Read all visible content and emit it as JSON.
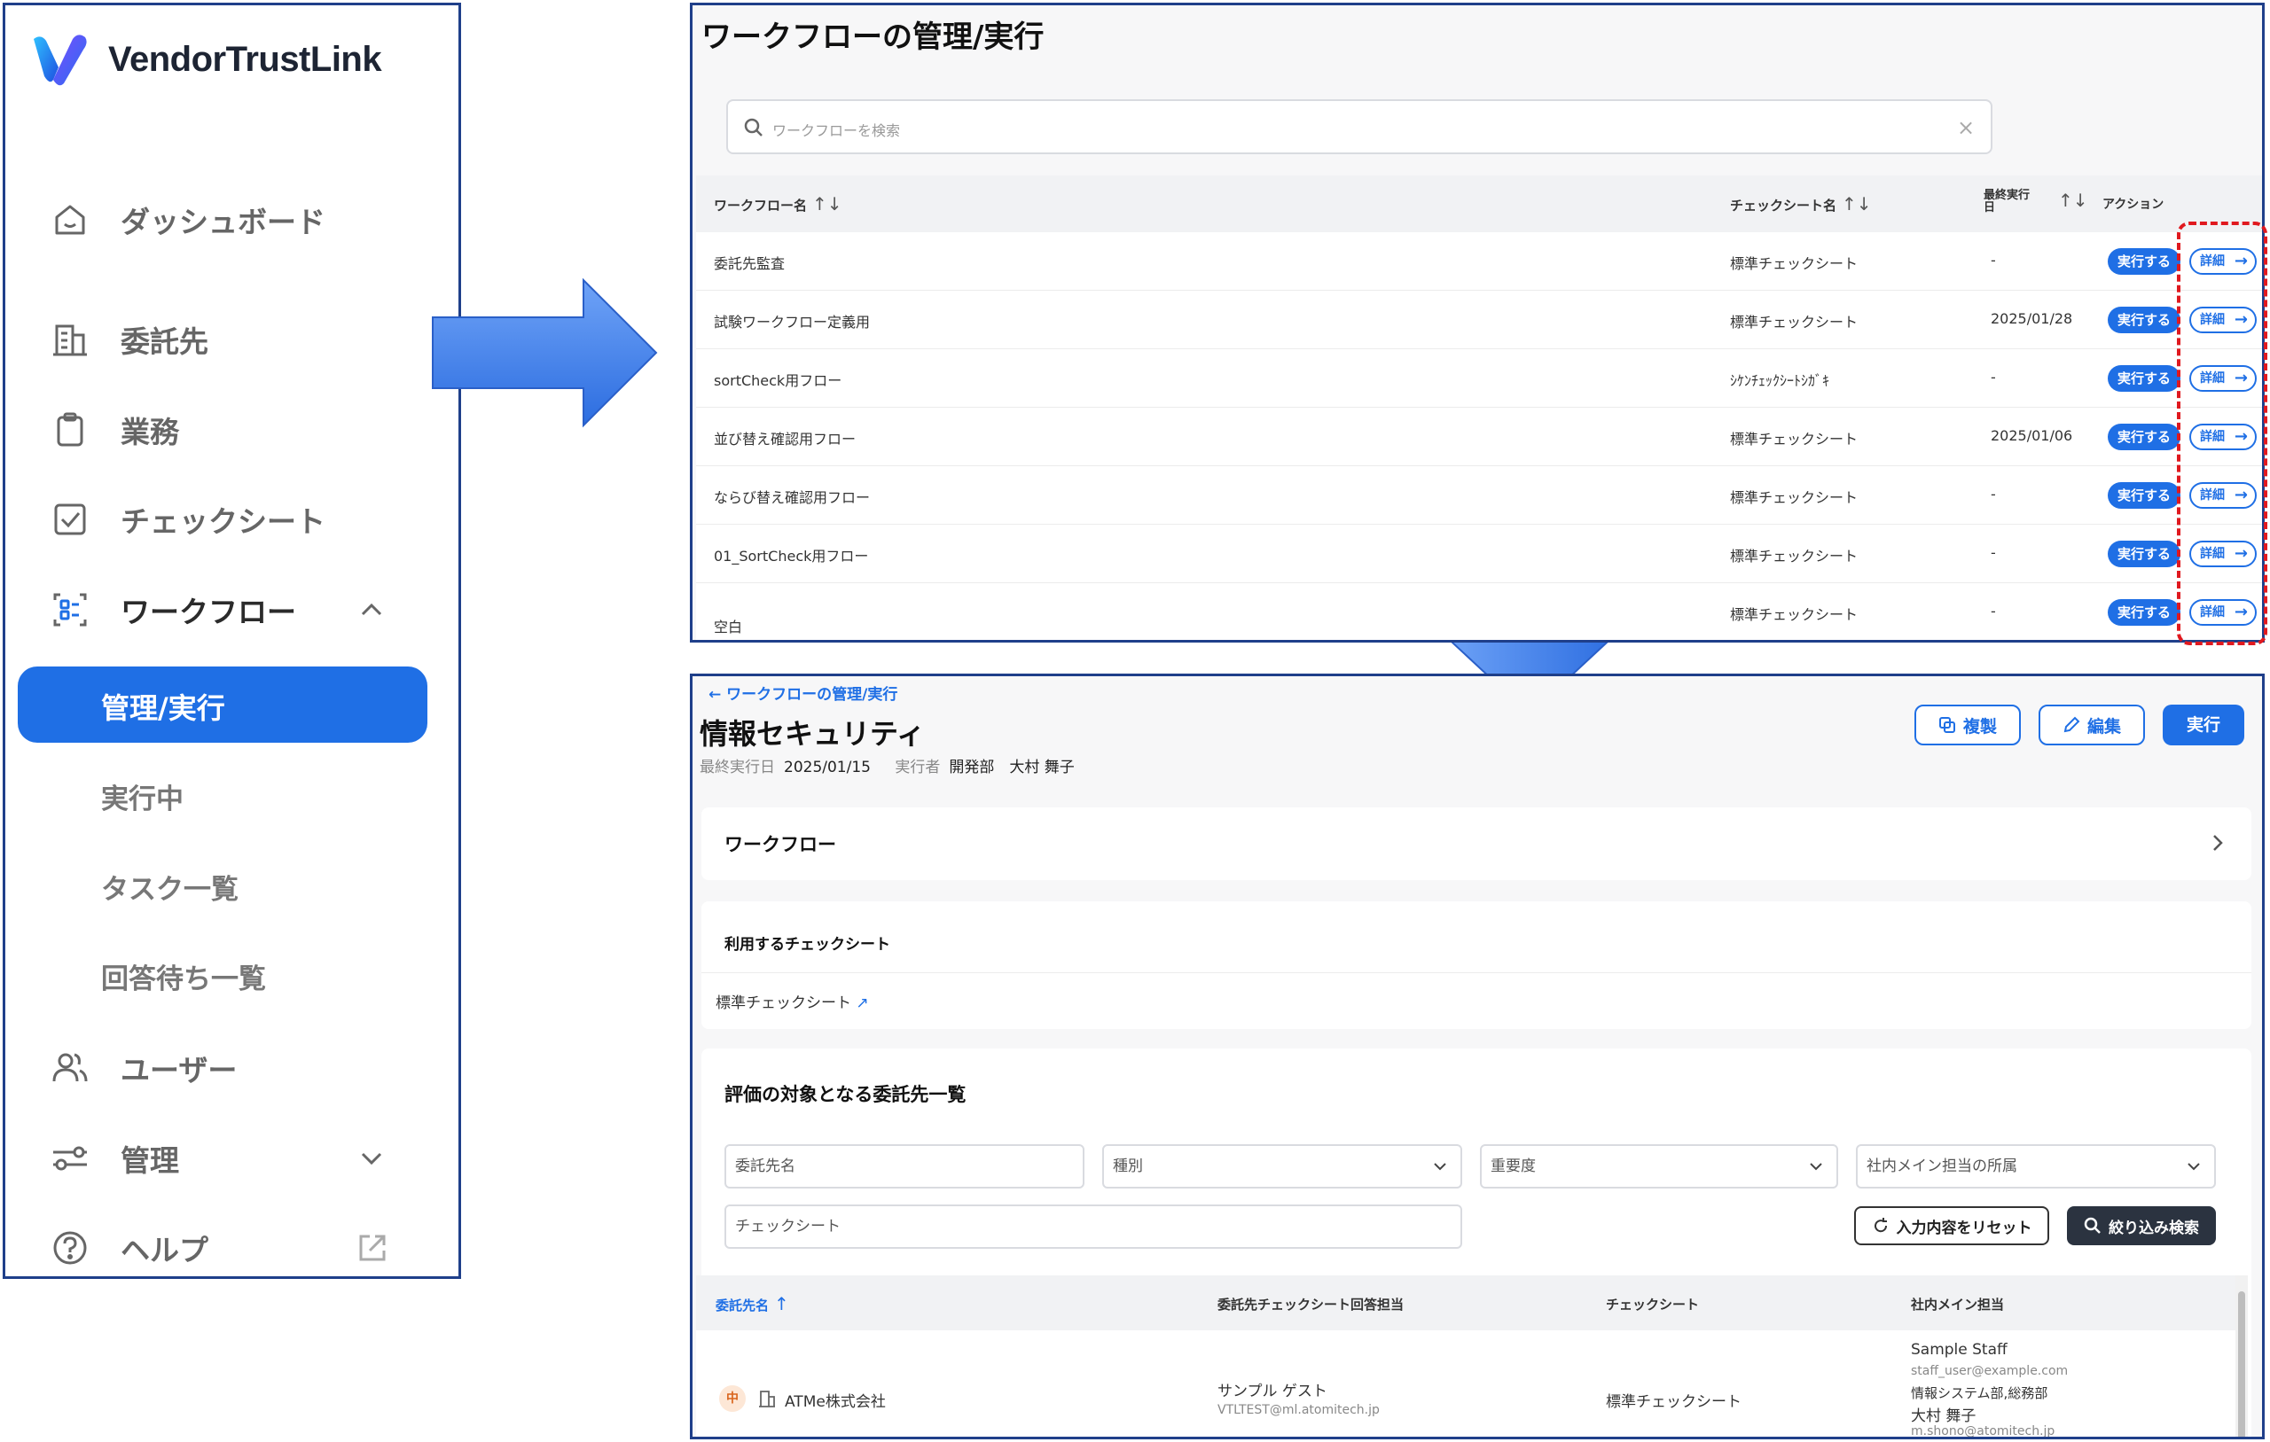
{
  "sidebar": {
    "brand": "VendorTrustLink",
    "items": [
      {
        "label": "ダッシュボード",
        "icon": "home-icon"
      },
      {
        "label": "委託先",
        "icon": "building-icon"
      },
      {
        "label": "業務",
        "icon": "clipboard-icon"
      },
      {
        "label": "チェックシート",
        "icon": "checkbox-icon"
      },
      {
        "label": "ワークフロー",
        "icon": "workflow-icon"
      },
      {
        "label": "ユーザー",
        "icon": "users-icon"
      },
      {
        "label": "管理",
        "icon": "sliders-icon"
      },
      {
        "label": "ヘルプ",
        "icon": "help-icon"
      }
    ],
    "workflow_sub": [
      "管理/実行",
      "実行中",
      "タスク一覧",
      "回答待ち一覧"
    ],
    "accent": "#1f6fe5"
  },
  "workflow_list": {
    "title": "ワークフローの管理/実行",
    "search_placeholder": "ワークフローを検索",
    "columns": {
      "name": "ワークフロー名",
      "sheet": "チェックシート名",
      "last_run": "最終実行日",
      "action": "アクション"
    },
    "run_label": "実行する",
    "detail_label": "詳細",
    "rows": [
      {
        "name": "委託先監査",
        "sheet": "標準チェックシート",
        "last_run": "-"
      },
      {
        "name": "試験ワークフロー定義用",
        "sheet": "標準チェックシート",
        "last_run": "2025/01/28"
      },
      {
        "name": "sortCheck用フロー",
        "sheet": "ｼｹﾝﾁｪｯｸｼｰﾄｼｶﾞｷ",
        "last_run": "-"
      },
      {
        "name": "並び替え確認用フロー",
        "sheet": "標準チェックシート",
        "last_run": "2025/01/06"
      },
      {
        "name": "ならび替え確認用フロー",
        "sheet": "標準チェックシート",
        "last_run": "-"
      },
      {
        "name": "01_SortCheck用フロー",
        "sheet": "標準チェックシート",
        "last_run": "-"
      },
      {
        "name": "空白",
        "sheet": "標準チェックシート",
        "last_run": "-"
      }
    ]
  },
  "workflow_detail": {
    "back_label": "ワークフローの管理/実行",
    "title": "情報セキュリティ",
    "last_run_label": "最終実行日",
    "last_run_value": "2025/01/15",
    "executor_label": "実行者",
    "executor_value": "開発部　大村 舞子",
    "buttons": {
      "copy": "複製",
      "edit": "編集",
      "run": "実行"
    },
    "workflow_section": "ワークフロー",
    "checksheet_section": "利用するチェックシート",
    "checksheet_link": "標準チェックシート",
    "vendors_section": "評価の対象となる委託先一覧",
    "filters": {
      "vendor_name": "委託先名",
      "category": "種別",
      "importance": "重要度",
      "department": "社内メイン担当の所属",
      "checksheet": "チェックシート",
      "reset": "入力内容をリセット",
      "search": "絞り込み検索"
    },
    "table": {
      "columns": {
        "vendor": "委託先名",
        "vendor_contact": "委託先チェックシート回答担当",
        "sheet": "チェックシート",
        "internal": "社内メイン担当"
      },
      "rows": [
        {
          "importance": "中",
          "vendor": "ATMe株式会社",
          "contact_name": "サンプル ゲスト",
          "contact_email": "VTLTEST@ml.atomitech.jp",
          "sheet": "標準チェックシート",
          "internal_name": "Sample Staff",
          "internal_email": "staff_user@example.com",
          "internal_dept": "情報システム部,総務部",
          "internal_name2": "大村 舞子",
          "internal_email2": "m.shono@atomitech.jp"
        }
      ]
    }
  }
}
